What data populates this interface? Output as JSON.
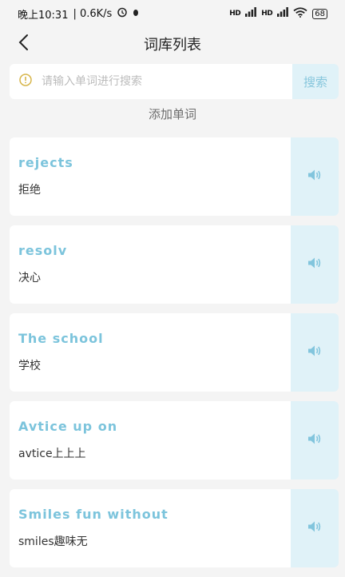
{
  "status_bar": {
    "time": "晚上10:31",
    "speed": "| 0.6K/s",
    "battery": "68",
    "signal_1": "HD",
    "signal_2": "HD"
  },
  "header": {
    "title": "词库列表"
  },
  "search": {
    "placeholder": "请输入单词进行搜索",
    "button_label": "搜索"
  },
  "add_word_label": "添加单词",
  "words": [
    {
      "en": "rejects",
      "zh": "拒绝"
    },
    {
      "en": "resolv",
      "zh": "决心"
    },
    {
      "en": "The school",
      "zh": "学校"
    },
    {
      "en": "Avtice up on",
      "zh": "avtice上上上"
    },
    {
      "en": "Smiles fun without",
      "zh": "smiles趣味无"
    }
  ],
  "colors": {
    "accent": "#7cc4dc",
    "button_bg": "#e0f2f8",
    "page_bg": "#f4f4f4"
  },
  "icons": {
    "back": "chevron-left-icon",
    "search_hint": "info-circle-icon",
    "sound": "speaker-icon"
  }
}
